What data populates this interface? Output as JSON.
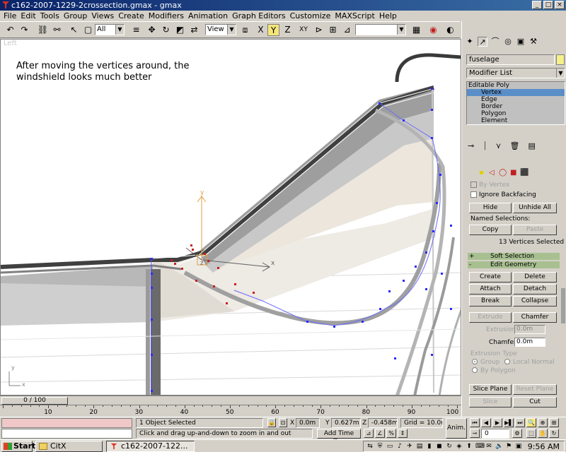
{
  "window": {
    "title": "c162-2007-1229-2crossection.gmax - gmax"
  },
  "menu": [
    "File",
    "Edit",
    "Tools",
    "Group",
    "Views",
    "Create",
    "Modifiers",
    "Animation",
    "Graph Editors",
    "Customize",
    "MAXScript",
    "Help"
  ],
  "toolbar": {
    "selection_filter": "All",
    "ref_coord": "View",
    "named_selection": ""
  },
  "viewport": {
    "label": "Left",
    "caption_line1": "After moving the vertices around, the",
    "caption_line2": "windshield looks much better",
    "axis_x": "x",
    "axis_y": "y",
    "axis_z": "z"
  },
  "command_panel": {
    "object_name": "fuselage",
    "modifier_list": "Modifier List",
    "stack": [
      "Editable Poly",
      "Vertex",
      "Edge",
      "Border",
      "Polygon",
      "Element"
    ],
    "selected_subobject": "Vertex",
    "selection": {
      "by_vertex": "By Vertex",
      "ignore_backfacing": "Ignore Backfacing",
      "hide": "Hide",
      "unhide_all": "Unhide All",
      "named_selections": "Named Selections:",
      "copy": "Copy",
      "paste": "Paste",
      "status": "13 Vertices Selected"
    },
    "soft_selection": {
      "sign": "+",
      "title": "Soft Selection"
    },
    "edit_geometry": {
      "sign": "-",
      "title": "Edit Geometry",
      "create": "Create",
      "delete": "Delete",
      "attach": "Attach",
      "detach": "Detach",
      "break": "Break",
      "collapse": "Collapse",
      "extrude": "Extrude",
      "chamfer": "Chamfer",
      "extrusion_label": "Extrusion",
      "extrusion_value": "0.0m",
      "chamfer_label": "Chamfer",
      "chamfer_value": "0.0m",
      "extrusion_type": "Extrusion Type",
      "group": "Group",
      "local_normal": "Local Normal",
      "by_polygon": "By Polygon",
      "slice_plane": "Slice Plane",
      "reset_plane": "Reset Plane",
      "slice": "Slice",
      "cut": "Cut"
    }
  },
  "timeline": {
    "frame": "0 / 100",
    "ticks": [
      "10",
      "20",
      "30",
      "40",
      "50",
      "60",
      "70",
      "80",
      "90",
      "100"
    ]
  },
  "status_bar": {
    "selected": "1 Object Selected",
    "prompt": "Click and drag up-and-down to zoom in and out",
    "x_label": "X",
    "x_value": "0.0m",
    "y_label": "Y",
    "y_value": "0.627m",
    "z_label": "Z",
    "z_value": "-0.458m",
    "grid": "Grid = 10.0m",
    "add_time_tag": "Add Time Tag",
    "anim": "Anim.",
    "frame_value": "0"
  },
  "taskbar": {
    "start": "Start",
    "tasks": [
      "CitX",
      "c162-2007-122..."
    ],
    "clock": "9:56 AM"
  },
  "colors": {
    "title_bar": "#0a246a",
    "selection_highlight": "#5a8ec8",
    "rollout_bar": "#a8c090",
    "vertex_selected": "#c81e1e",
    "vertex": "#2a2aff"
  }
}
